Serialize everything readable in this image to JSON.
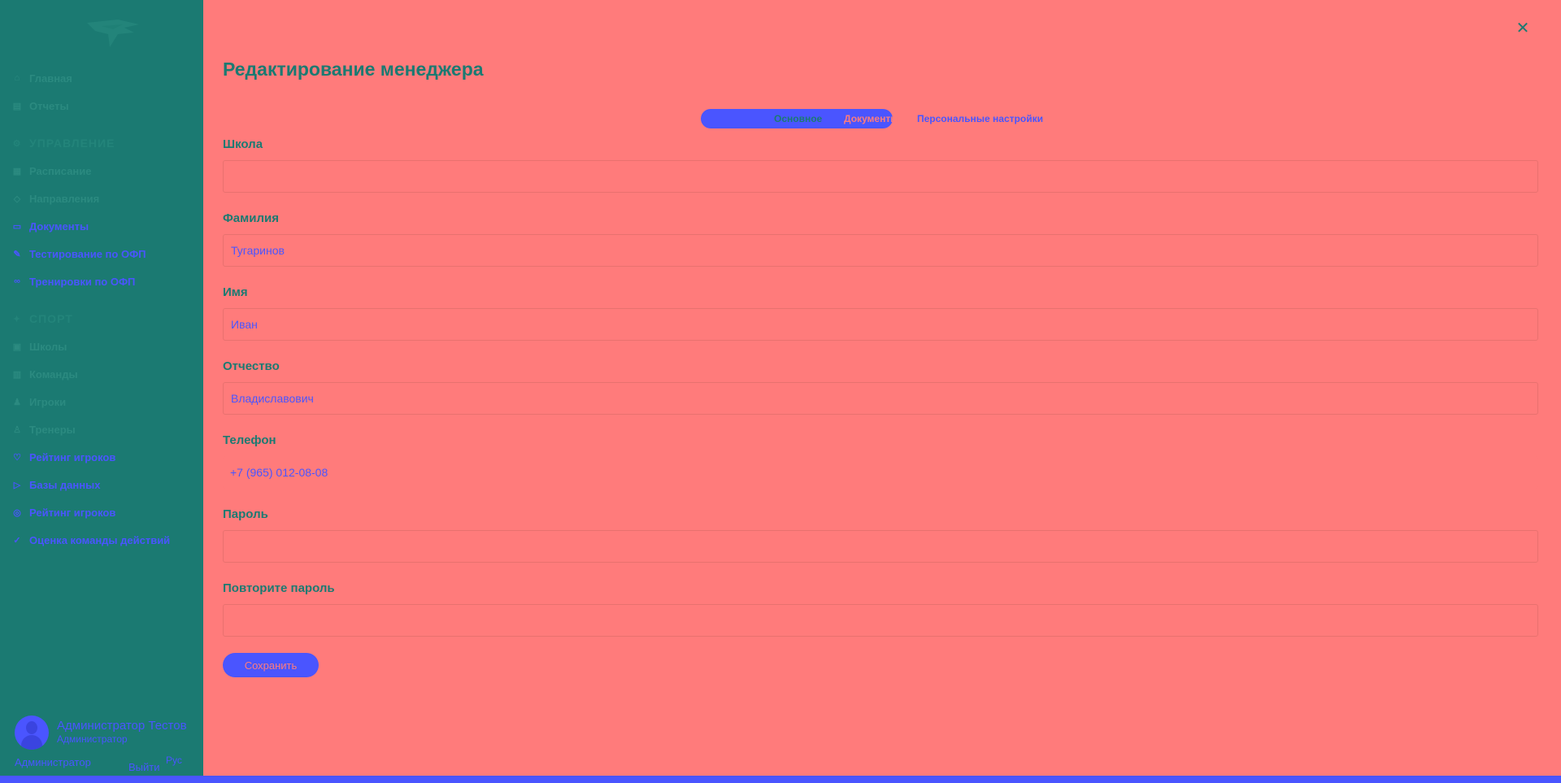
{
  "sidebar": {
    "logo_icon": "bird-logo-icon",
    "items": [
      {
        "label": "Главная",
        "icon": "home-icon",
        "glyph": "⌂"
      },
      {
        "label": "Отчеты",
        "icon": "report-icon",
        "glyph": "▤"
      },
      {
        "label": "УПРАВЛЕНИЕ",
        "icon": "gear-icon",
        "glyph": "⚙"
      },
      {
        "label": "Расписание",
        "icon": "calendar-icon",
        "glyph": "▦"
      },
      {
        "label": "Направления",
        "icon": "direction-icon",
        "glyph": "◇"
      },
      {
        "label": "Документы",
        "icon": "document-icon",
        "glyph": "▭"
      },
      {
        "label": "Тестирование по ОФП",
        "icon": "test-icon",
        "glyph": "✎"
      },
      {
        "label": "Тренировки по ОФП",
        "icon": "dumbbell-icon",
        "glyph": "∞"
      },
      {
        "label": "СПОРТ",
        "icon": "sport-icon",
        "glyph": "✦"
      },
      {
        "label": "Школы",
        "icon": "school-icon",
        "glyph": "▣"
      },
      {
        "label": "Команды",
        "icon": "team-icon",
        "glyph": "▥"
      },
      {
        "label": "Игроки",
        "icon": "player-icon",
        "glyph": "♟"
      },
      {
        "label": "Тренеры",
        "icon": "coach-icon",
        "glyph": "♙"
      },
      {
        "label": "Рейтинг игроков",
        "icon": "rating-icon",
        "glyph": "♡"
      },
      {
        "label": "Базы данных",
        "icon": "database-icon",
        "glyph": "▷"
      },
      {
        "label": "Рейтинг игроков",
        "icon": "star-icon",
        "glyph": "◎"
      },
      {
        "label": "Оценка команды действий",
        "icon": "score-icon",
        "glyph": "✓"
      }
    ],
    "user": {
      "name": "Администратор Тестов",
      "subtitle": "Администратор",
      "role": "Администратор",
      "logout": "Выйти",
      "lang": "Рус"
    }
  },
  "modal": {
    "title": "Редактирование менеджера",
    "close_icon": "close-icon",
    "tabs": [
      "Основное",
      "Документы",
      "Персональные настройки"
    ],
    "fields": {
      "school": {
        "label": "Школа",
        "value": ""
      },
      "last_name": {
        "label": "Фамилия",
        "value": "Тугаринов"
      },
      "first_name": {
        "label": "Имя",
        "value": "Иван"
      },
      "patronymic": {
        "label": "Отчество",
        "value": "Владиславович"
      },
      "phone": {
        "label": "Телефон",
        "value": "+7 (965) 012-08-08"
      },
      "password": {
        "label": "Пароль",
        "value": ""
      },
      "password_repeat": {
        "label": "Повторите пароль",
        "value": ""
      }
    },
    "save_label": "Сохранить"
  },
  "colors": {
    "background": "#ff7b7b",
    "sidebar": "#1b7a72",
    "accent": "#4a55ff"
  }
}
